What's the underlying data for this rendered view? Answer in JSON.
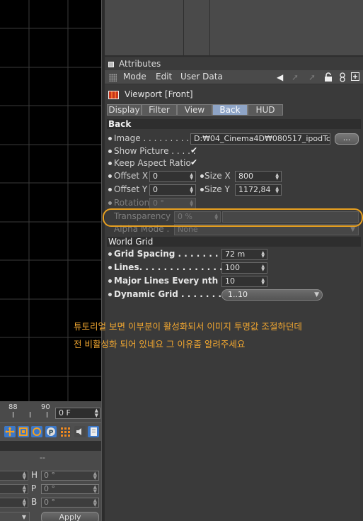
{
  "timeline": {
    "marks": [
      "88",
      "90"
    ],
    "frame_field": "0 F"
  },
  "coords": {
    "dash": "--",
    "rows": [
      {
        "label": "H",
        "value": "0 °"
      },
      {
        "label": "P",
        "value": "0 °"
      },
      {
        "label": "B",
        "value": "0 °"
      }
    ],
    "apply_label": "Apply"
  },
  "attributes": {
    "title": "Attributes",
    "menu": [
      "Mode",
      "Edit",
      "User Data"
    ],
    "object_name": "Viewport [Front]",
    "tabs": [
      "Display",
      "Filter",
      "View",
      "Back",
      "HUD"
    ],
    "active_tab": "Back"
  },
  "back": {
    "heading": "Back",
    "image_label": "Image . . . . . . . . . . .",
    "image_value": "D:₩04_Cinema4D₩080517_ipodTc",
    "browse_label": "...",
    "show_picture_label": "Show Picture . . . . .",
    "show_picture_checked": true,
    "keep_aspect_label": "Keep Aspect Ratio",
    "keep_aspect_checked": true,
    "offset_x_label": "Offset X",
    "offset_x_value": "0",
    "size_x_label": "Size X",
    "size_x_value": "800",
    "offset_y_label": "Offset Y",
    "offset_y_value": "0",
    "size_y_label": "Size Y",
    "size_y_value": "1172,84",
    "rotation_label": "Rotation",
    "rotation_value": "0 °",
    "transparency_label": "Transparency",
    "transparency_value": "0 %",
    "alpha_mode_label": "Alpha Mode .",
    "alpha_mode_value": "None"
  },
  "world_grid": {
    "heading": "World Grid",
    "grid_spacing_label": "Grid Spacing . . . . . . . . .",
    "grid_spacing_value": "72 m",
    "lines_label": "Lines. . . . . . . . . . . . . . . . . .",
    "lines_value": "100",
    "major_lines_label": "Major Lines Every nth",
    "major_lines_value": "10",
    "dynamic_grid_label": "Dynamic Grid . . . . . . . . .",
    "dynamic_grid_value": "1..10"
  },
  "annotation": {
    "line1": "튜토리얼 보면 이부분이 활성화되서 이미지 투명값 조절하던데",
    "line2": "전 비활성화 되어 있네요 그 이유좀 알려주세요",
    "color": "#f0a630"
  },
  "colors": {
    "highlight": "#e8a020",
    "active_tab": "#8ea4c6"
  },
  "icons": [
    "move-icon",
    "scale-icon",
    "rotate-icon",
    "p-icon",
    "grid-icon",
    "sound-icon",
    "doc-icon",
    "arrow-left-icon",
    "cursor-icon",
    "lock-icon",
    "figure8-icon",
    "new-panel-icon"
  ]
}
